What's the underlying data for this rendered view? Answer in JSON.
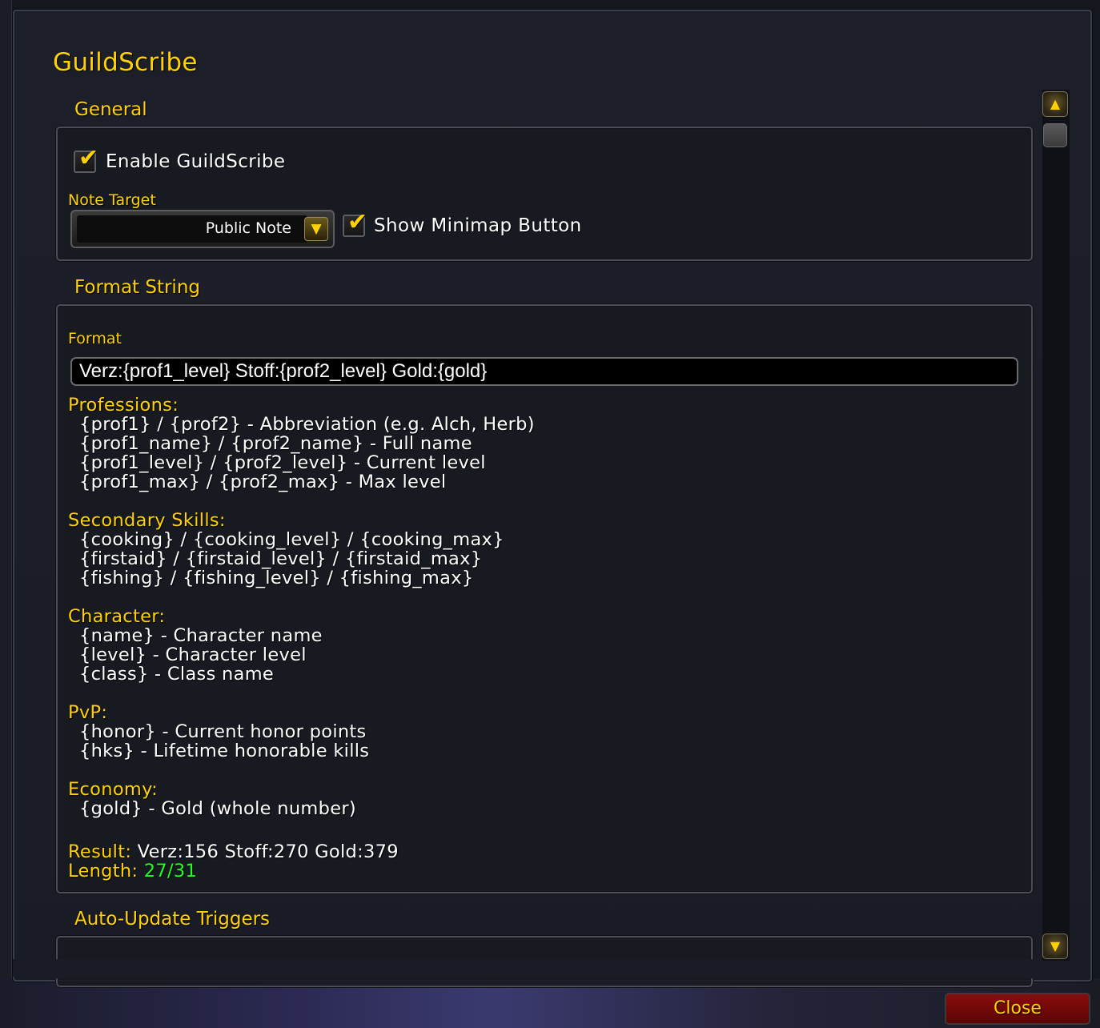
{
  "window": {
    "title": "GuildScribe"
  },
  "general": {
    "title": "General",
    "enable_label": "Enable GuildScribe",
    "enable_checked": true,
    "note_target_label": "Note Target",
    "note_target_value": "Public Note",
    "minimap_label": "Show Minimap Button",
    "minimap_checked": true
  },
  "format_section": {
    "title": "Format String",
    "format_label": "Format",
    "format_value": "Verz:{prof1_level} Stoff:{prof2_level} Gold:{gold}",
    "professions": {
      "heading": "Professions:",
      "lines": [
        "{prof1} / {prof2} - Abbreviation (e.g. Alch, Herb)",
        "{prof1_name} / {prof2_name} - Full name",
        "{prof1_level} / {prof2_level} - Current level",
        "{prof1_max} / {prof2_max} - Max level"
      ]
    },
    "secondary": {
      "heading": "Secondary Skills:",
      "lines": [
        "{cooking} / {cooking_level} / {cooking_max}",
        "{firstaid} / {firstaid_level} / {firstaid_max}",
        "{fishing} / {fishing_level} / {fishing_max}"
      ]
    },
    "character": {
      "heading": "Character:",
      "lines": [
        "{name} - Character name",
        "{level} - Character level",
        "{class} - Class name"
      ]
    },
    "pvp": {
      "heading": "PvP:",
      "lines": [
        "{honor} - Current honor points",
        "{hks} - Lifetime honorable kills"
      ]
    },
    "economy": {
      "heading": "Economy:",
      "lines": [
        "{gold} - Gold (whole number)"
      ]
    },
    "result_label": "Result:",
    "result_value": "Verz:156 Stoff:270 Gold:379",
    "length_label": "Length:",
    "length_value": "27/31"
  },
  "auto_update": {
    "title": "Auto-Update Triggers"
  },
  "footer": {
    "close_label": "Close"
  },
  "colors": {
    "gold": "#ffd100",
    "green": "#20ff20",
    "close_red": "#8a0c0c"
  },
  "icons": {
    "check": "checkmark-icon",
    "dropdown": "arrow-down-icon",
    "scroll_up": "scroll-up-icon",
    "scroll_down": "scroll-down-icon"
  }
}
